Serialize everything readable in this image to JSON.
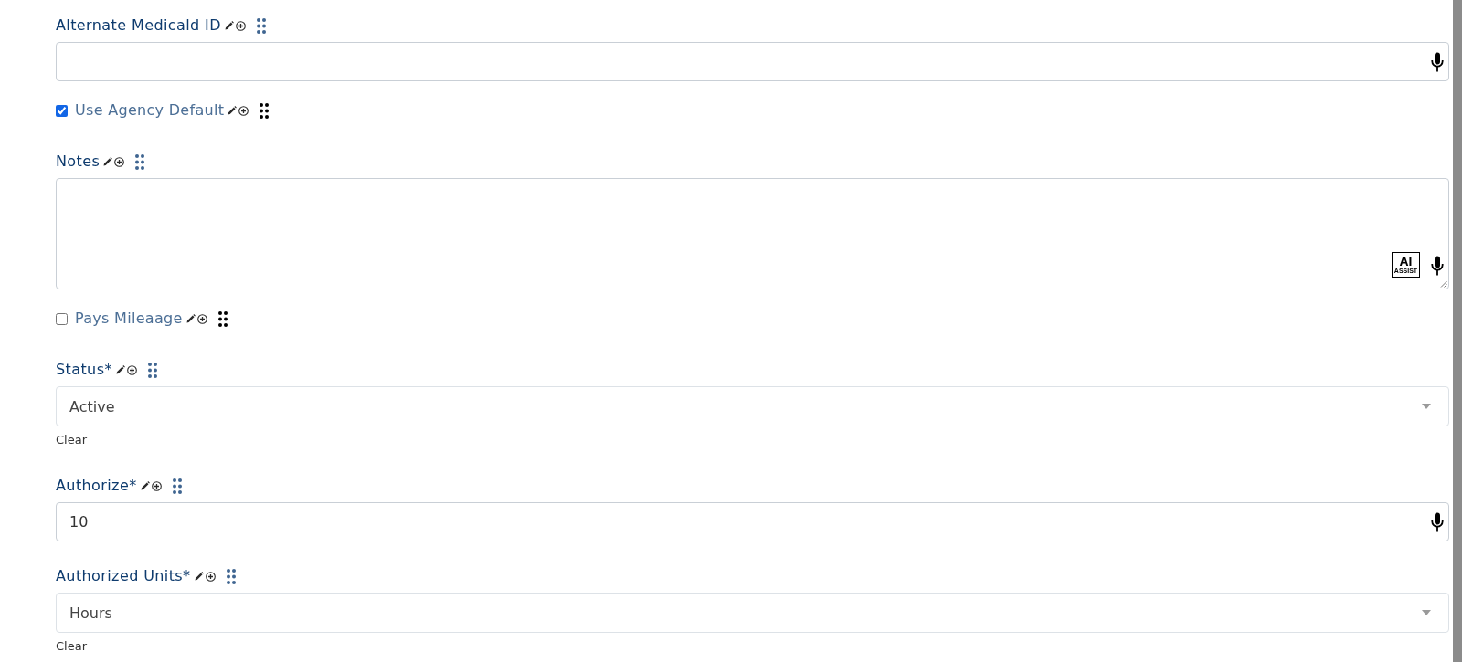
{
  "fields": [
    {
      "kind": "text",
      "label": "Alternate Medicald ID",
      "voice_input": true
    },
    {
      "kind": "checkbox",
      "label": "Use Agency Default",
      "checked": true
    },
    {
      "kind": "textarea",
      "label": "Notes",
      "ai_assist_button": {
        "title": "AI",
        "caption": "ASSIST"
      },
      "voice_input": true
    },
    {
      "kind": "checkbox",
      "label": "Pays Mileaage",
      "checked": false
    },
    {
      "kind": "select",
      "label": "Status*",
      "value": "Active",
      "clear_link": "Clear"
    },
    {
      "kind": "text",
      "label": "Authorize*",
      "value": "10",
      "voice_input": true
    },
    {
      "kind": "select",
      "label": "Authorized Units*",
      "value": "Hours",
      "clear_link": "Clear"
    }
  ]
}
